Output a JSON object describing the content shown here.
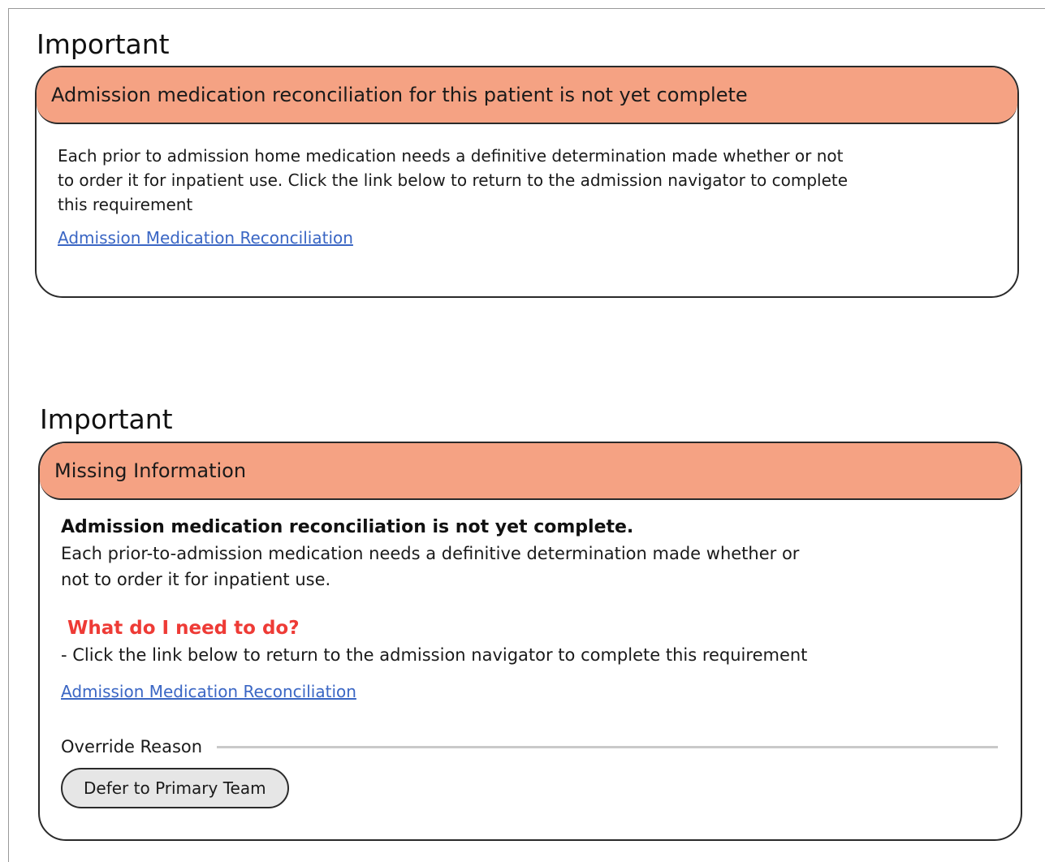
{
  "alert1": {
    "heading": "Important",
    "header_text": "Admission medication reconciliation for this patient is not yet complete",
    "body_lines": [
      "Each prior to admission home medication needs a definitive determination made whether or not",
      "to order it for inpatient use. Click the link below to return to the admission navigator to complete",
      "this requirement"
    ],
    "link_text": "Admission Medication Reconciliation"
  },
  "alert2": {
    "heading": "Important",
    "header_text": "Missing Information",
    "bold_text": "Admission medication reconciliation is not yet complete.",
    "body_lines": [
      "Each prior-to-admission medication needs a definitive determination made whether or",
      "not to order it for inpatient use."
    ],
    "question": "What do I need to do?",
    "instruction": "- Click the link below to return to the admission navigator to complete this requirement",
    "link_text": "Admission Medication Reconciliation",
    "override_label": "Override Reason",
    "override_button": "Defer to Primary Team"
  },
  "colors": {
    "header_bg": "#f5a283",
    "link": "#3a66c4",
    "question": "#ee3b36",
    "button_bg": "#e6e6e6"
  }
}
